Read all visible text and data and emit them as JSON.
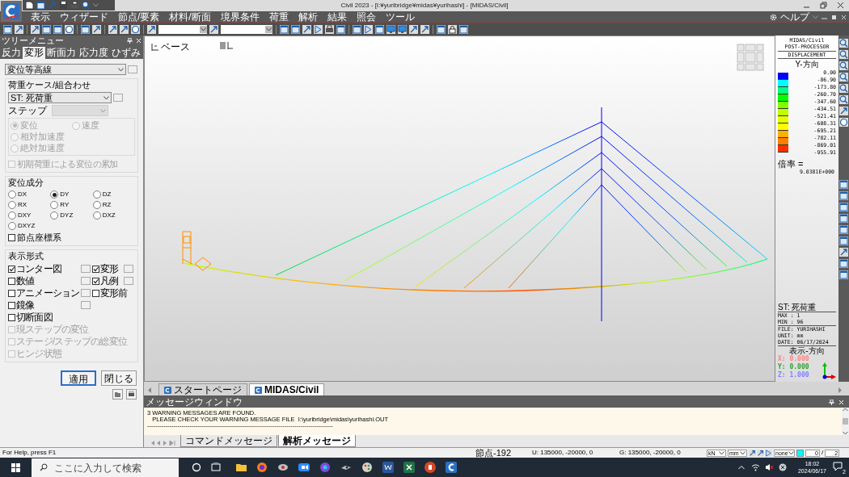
{
  "window": {
    "title": "Civil 2023 - [I:¥yuribridge¥midas¥yurihashi] - [MIDAS/Civil]"
  },
  "menu": [
    {
      "label": "表示"
    },
    {
      "label": "ウィザード"
    },
    {
      "label": "節点/要素"
    },
    {
      "label": "材料/断面"
    },
    {
      "label": "境界条件"
    },
    {
      "label": "荷重"
    },
    {
      "label": "解析"
    },
    {
      "label": "結果"
    },
    {
      "label": "照会"
    },
    {
      "label": "ツール"
    }
  ],
  "help_menu": "ヘルプ",
  "tree_menu": {
    "title": "ツリーメニュー",
    "tabs": [
      {
        "label": "反力",
        "selected": false
      },
      {
        "label": "変形",
        "selected": true
      },
      {
        "label": "断面力",
        "selected": false
      },
      {
        "label": "応力度",
        "selected": false
      },
      {
        "label": "ひずみ",
        "selected": false
      }
    ],
    "result_type": "変位等高線",
    "load_case": {
      "title": "荷重ケース/組合わせ",
      "value": "ST: 死荷重",
      "step_label": "ステップ",
      "options": [
        {
          "label": "変位",
          "selected": true
        },
        {
          "label": "速度",
          "selected": false
        },
        {
          "label": "相対加速度",
          "selected": false
        },
        {
          "label": "絶対加速度",
          "selected": false
        }
      ],
      "accumulate": {
        "label": "初期荷重による変位の累加",
        "checked": false
      }
    },
    "components": {
      "title": "変位成分",
      "options": [
        {
          "label": "DX",
          "selected": false
        },
        {
          "label": "DY",
          "selected": true
        },
        {
          "label": "DZ",
          "selected": false
        },
        {
          "label": "RX",
          "selected": false
        },
        {
          "label": "RY",
          "selected": false
        },
        {
          "label": "RZ",
          "selected": false
        },
        {
          "label": "DXY",
          "selected": false
        },
        {
          "label": "DYZ",
          "selected": false
        },
        {
          "label": "DXZ",
          "selected": false
        },
        {
          "label": "DXYZ",
          "selected": false
        }
      ],
      "node_coords": {
        "label": "節点座標系",
        "checked": false
      }
    },
    "display": {
      "title": "表示形式",
      "items": [
        {
          "label": "コンター図",
          "checked": true,
          "disabled": false,
          "more": true,
          "kind": "pair"
        },
        {
          "label": "変形",
          "checked": true,
          "disabled": false,
          "more": true,
          "kind": "pair"
        },
        {
          "label": "数値",
          "checked": false,
          "disabled": false,
          "more": true,
          "kind": "pair"
        },
        {
          "label": "凡例",
          "checked": true,
          "disabled": false,
          "more": true,
          "kind": "pair"
        },
        {
          "label": "アニメーション",
          "checked": false,
          "disabled": false,
          "more": true,
          "kind": "pair"
        },
        {
          "label": "変形前",
          "checked": false,
          "disabled": false,
          "more": false,
          "kind": "pair"
        },
        {
          "label": "鏡像",
          "checked": false,
          "disabled": false,
          "more": true,
          "kind": "pair"
        },
        {
          "label": "切断面図",
          "checked": false,
          "disabled": false,
          "more": false,
          "kind": "wide"
        },
        {
          "label": "現ステップの変位",
          "checked": false,
          "disabled": true,
          "more": false,
          "kind": "wide"
        },
        {
          "label": "ステージ/ステップの総変位",
          "checked": false,
          "disabled": true,
          "more": false,
          "kind": "wide"
        },
        {
          "label": "ヒンジ状態",
          "checked": false,
          "disabled": true,
          "more": false,
          "kind": "wide"
        }
      ]
    },
    "buttons": [
      {
        "label": "適用",
        "default": true
      },
      {
        "label": "閉じる",
        "default": false
      }
    ]
  },
  "view": {
    "label": "ベース"
  },
  "legend": {
    "header": [
      "MIDAS/Civil",
      "POST-PROCESSOR"
    ],
    "title": "DISPLACEMENT",
    "direction": "Y-方向",
    "bands": [
      {
        "color": "#0000ff"
      },
      {
        "color": "#00ffff"
      },
      {
        "color": "#00ff80"
      },
      {
        "color": "#00ff00"
      },
      {
        "color": "#80ff00"
      },
      {
        "color": "#c0ff00"
      },
      {
        "color": "#e8ff00"
      },
      {
        "color": "#ffff00"
      },
      {
        "color": "#ffb000"
      },
      {
        "color": "#ff8000"
      },
      {
        "color": "#ff3000"
      }
    ],
    "values": [
      "0.00",
      "-86.90",
      "-173.80",
      "-260.70",
      "-347.60",
      "-434.51",
      "-521.41",
      "-608.31",
      "-695.21",
      "-782.11",
      "-869.01",
      "-955.91"
    ],
    "scale_label": "倍率 =",
    "scale_value": "9.0381E+000",
    "load_case": "ST: 死荷重",
    "max": "MAX : 1",
    "min": "MIN : 96",
    "file": "FILE: YURIHASHI",
    "unit": "UNIT: mm",
    "date": "DATE: 06/17/2024",
    "view_direction": "表示-方向",
    "axes": [
      {
        "label": "X: 0.000",
        "color": "#ff8080"
      },
      {
        "label": "Y: 0.000",
        "color": "#30a030"
      },
      {
        "label": "Z: 1.000",
        "color": "#8080ff"
      }
    ]
  },
  "document_tabs": [
    {
      "label": "スタートページ",
      "selected": false
    },
    {
      "label": "MIDAS/Civil",
      "selected": true
    }
  ],
  "message_window": {
    "title": "メッセージウィンドウ",
    "lines": [
      "3 WARNING MESSAGES ARE FOUND.",
      "   PLEASE CHECK YOUR WARNING MESSAGE FILE  I:\\yuribridge\\midas\\yurihashi.OUT",
      "--------------------------------------------------------------------------------------------"
    ],
    "tabs": [
      {
        "label": "コマンドメッセージ",
        "selected": false
      },
      {
        "label": "解析メッセージ",
        "selected": true
      }
    ]
  },
  "status_bar": {
    "help": "For Help, press F1",
    "node": "節点-192",
    "u": "U: 135000, -20000, 0",
    "g": "G: 135000, -20000, 0",
    "force_unit": "kN",
    "length_unit": "mm",
    "filter": "none",
    "field_a": "0",
    "separator": "/",
    "field_b": "2"
  },
  "taskbar": {
    "search_placeholder": "ここに入力して検索",
    "time": "18:02",
    "date": "2024/06/17",
    "notifications": "2"
  }
}
